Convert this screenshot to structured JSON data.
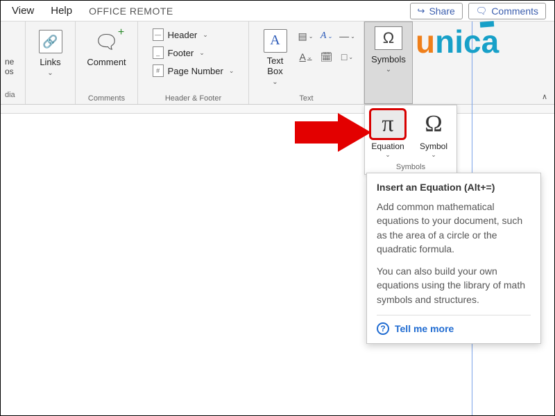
{
  "menu": {
    "view": "View",
    "help": "Help",
    "office_remote": "OFFICE REMOTE",
    "share": "Share",
    "comments": "Comments"
  },
  "ribbon": {
    "media_group": {
      "line1": "ne",
      "line2": "os",
      "label": "dia"
    },
    "links": {
      "label": "Links",
      "group": ""
    },
    "comments": {
      "btn": "Comment",
      "group": "Comments"
    },
    "hf": {
      "header": "Header",
      "footer": "Footer",
      "page_number": "Page Number",
      "group": "Header & Footer"
    },
    "text": {
      "text_box": "Text\nBox",
      "group": "Text"
    },
    "symbols": {
      "btn": "Symbols",
      "group": ""
    }
  },
  "drop": {
    "equation": "Equation",
    "symbol": "Symbol",
    "group": "Symbols"
  },
  "tooltip": {
    "title": "Insert an Equation (Alt+=)",
    "p1": "Add common mathematical equations to your document, such as the area of a circle or the quadratic formula.",
    "p2": "You can also build your own equations using the library of math symbols and structures.",
    "more": "Tell me more"
  },
  "logo": {
    "u": "u",
    "nica": "nica"
  }
}
